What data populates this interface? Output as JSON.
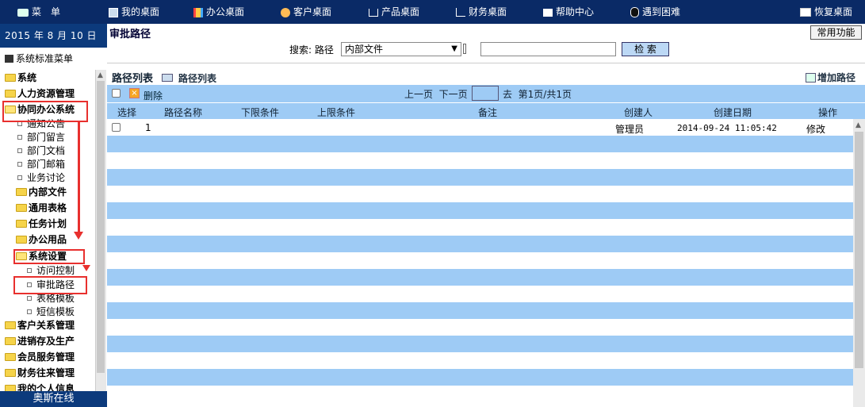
{
  "topbar": {
    "menu": "菜　单",
    "items": [
      "我的桌面",
      "办公桌面",
      "客户桌面",
      "产品桌面",
      "财务桌面",
      "帮助中心",
      "遇到困难",
      "恢复桌面"
    ]
  },
  "date": "2015  年 8 月  10  日",
  "sidebar": {
    "head": "系统标准菜单",
    "items": [
      "系统",
      "人力资源管理",
      "协同办公系统",
      "通知公告",
      "部门留言",
      "部门文档",
      "部门邮箱",
      "业务讨论",
      "内部文件",
      "通用表格",
      "任务计划",
      "办公用品",
      "系统设置",
      "访问控制",
      "审批路径",
      "表格模板",
      "短信模板",
      "客户关系管理",
      "进销存及生产",
      "会员服务管理",
      "财务往来管理",
      "我的个人信息"
    ],
    "footer": "奥斯在线"
  },
  "main": {
    "title": "审批路径",
    "quick": "常用功能",
    "search_label": "搜索: 路径",
    "select_value": "内部文件",
    "search_btn": "检 索",
    "list_title": "路径列表",
    "list_link": "路径列表",
    "add_link": "增加路径",
    "delete": "删除",
    "prev": "上一页",
    "next": "下一页",
    "go": "去",
    "page_info": "第1页/共1页",
    "columns": [
      "选择",
      "路径名称",
      "下限条件",
      "上限条件",
      "备注",
      "创建人",
      "创建日期",
      "操作"
    ],
    "rows": [
      {
        "no": "1",
        "creator": "管理员",
        "date": "2014-09-24 11:05:42",
        "op": "修改"
      }
    ]
  }
}
